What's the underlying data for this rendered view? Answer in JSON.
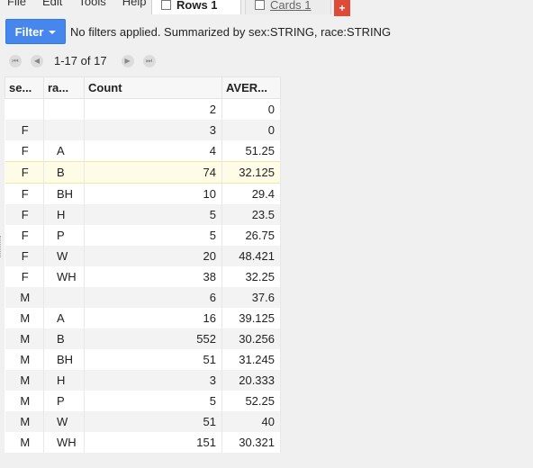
{
  "menu": [
    "File",
    "Edit",
    "Tools",
    "Help"
  ],
  "tabs": [
    {
      "label": "Rows 1",
      "active": true
    },
    {
      "label": "Cards 1",
      "active": false
    }
  ],
  "add_tab": "+",
  "filter": {
    "button_label": "Filter",
    "summary": "No filters applied. Summarized by sex:STRING, race:STRING"
  },
  "pager": {
    "first": "⏮",
    "prev": "◀",
    "label": "1-17 of 17",
    "next": "▶",
    "last": "⏭"
  },
  "table": {
    "columns": [
      "se...",
      "ra...",
      "Count",
      "AVER..."
    ],
    "rows": [
      [
        "",
        "",
        "2",
        "0"
      ],
      [
        "F",
        "",
        "3",
        "0"
      ],
      [
        "F",
        "A",
        "4",
        "51.25"
      ],
      [
        "F",
        "B",
        "74",
        "32.125"
      ],
      [
        "F",
        "BH",
        "10",
        "29.4"
      ],
      [
        "F",
        "H",
        "5",
        "23.5"
      ],
      [
        "F",
        "P",
        "5",
        "26.75"
      ],
      [
        "F",
        "W",
        "20",
        "48.421"
      ],
      [
        "F",
        "WH",
        "38",
        "32.25"
      ],
      [
        "M",
        "",
        "6",
        "37.6"
      ],
      [
        "M",
        "A",
        "16",
        "39.125"
      ],
      [
        "M",
        "B",
        "552",
        "30.256"
      ],
      [
        "M",
        "BH",
        "51",
        "31.245"
      ],
      [
        "M",
        "H",
        "3",
        "20.333"
      ],
      [
        "M",
        "P",
        "5",
        "52.25"
      ],
      [
        "M",
        "W",
        "51",
        "40"
      ],
      [
        "M",
        "WH",
        "151",
        "30.321"
      ]
    ],
    "highlighted_row": 3
  },
  "colors": {
    "filter_button": "#4787ed",
    "add_tab": "#dd4b39",
    "highlight": "#fefbe6"
  }
}
